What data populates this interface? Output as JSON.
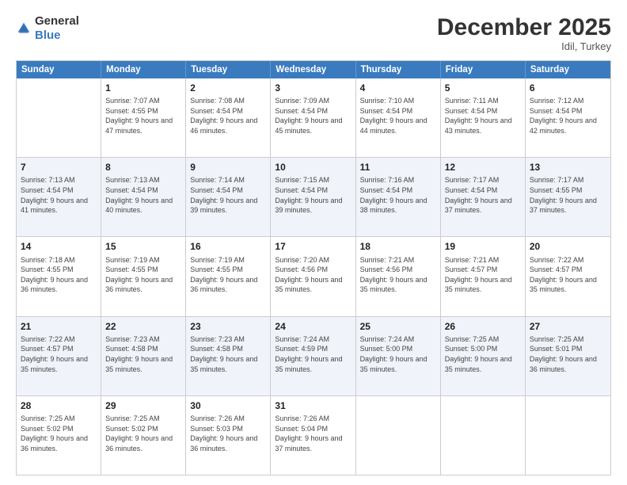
{
  "logo": {
    "general": "General",
    "blue": "Blue"
  },
  "header": {
    "month": "December 2025",
    "location": "Idil, Turkey"
  },
  "weekdays": [
    "Sunday",
    "Monday",
    "Tuesday",
    "Wednesday",
    "Thursday",
    "Friday",
    "Saturday"
  ],
  "rows": [
    [
      {
        "day": "",
        "sunrise": "",
        "sunset": "",
        "daylight": ""
      },
      {
        "day": "1",
        "sunrise": "Sunrise: 7:07 AM",
        "sunset": "Sunset: 4:55 PM",
        "daylight": "Daylight: 9 hours and 47 minutes."
      },
      {
        "day": "2",
        "sunrise": "Sunrise: 7:08 AM",
        "sunset": "Sunset: 4:54 PM",
        "daylight": "Daylight: 9 hours and 46 minutes."
      },
      {
        "day": "3",
        "sunrise": "Sunrise: 7:09 AM",
        "sunset": "Sunset: 4:54 PM",
        "daylight": "Daylight: 9 hours and 45 minutes."
      },
      {
        "day": "4",
        "sunrise": "Sunrise: 7:10 AM",
        "sunset": "Sunset: 4:54 PM",
        "daylight": "Daylight: 9 hours and 44 minutes."
      },
      {
        "day": "5",
        "sunrise": "Sunrise: 7:11 AM",
        "sunset": "Sunset: 4:54 PM",
        "daylight": "Daylight: 9 hours and 43 minutes."
      },
      {
        "day": "6",
        "sunrise": "Sunrise: 7:12 AM",
        "sunset": "Sunset: 4:54 PM",
        "daylight": "Daylight: 9 hours and 42 minutes."
      }
    ],
    [
      {
        "day": "7",
        "sunrise": "Sunrise: 7:13 AM",
        "sunset": "Sunset: 4:54 PM",
        "daylight": "Daylight: 9 hours and 41 minutes."
      },
      {
        "day": "8",
        "sunrise": "Sunrise: 7:13 AM",
        "sunset": "Sunset: 4:54 PM",
        "daylight": "Daylight: 9 hours and 40 minutes."
      },
      {
        "day": "9",
        "sunrise": "Sunrise: 7:14 AM",
        "sunset": "Sunset: 4:54 PM",
        "daylight": "Daylight: 9 hours and 39 minutes."
      },
      {
        "day": "10",
        "sunrise": "Sunrise: 7:15 AM",
        "sunset": "Sunset: 4:54 PM",
        "daylight": "Daylight: 9 hours and 39 minutes."
      },
      {
        "day": "11",
        "sunrise": "Sunrise: 7:16 AM",
        "sunset": "Sunset: 4:54 PM",
        "daylight": "Daylight: 9 hours and 38 minutes."
      },
      {
        "day": "12",
        "sunrise": "Sunrise: 7:17 AM",
        "sunset": "Sunset: 4:54 PM",
        "daylight": "Daylight: 9 hours and 37 minutes."
      },
      {
        "day": "13",
        "sunrise": "Sunrise: 7:17 AM",
        "sunset": "Sunset: 4:55 PM",
        "daylight": "Daylight: 9 hours and 37 minutes."
      }
    ],
    [
      {
        "day": "14",
        "sunrise": "Sunrise: 7:18 AM",
        "sunset": "Sunset: 4:55 PM",
        "daylight": "Daylight: 9 hours and 36 minutes."
      },
      {
        "day": "15",
        "sunrise": "Sunrise: 7:19 AM",
        "sunset": "Sunset: 4:55 PM",
        "daylight": "Daylight: 9 hours and 36 minutes."
      },
      {
        "day": "16",
        "sunrise": "Sunrise: 7:19 AM",
        "sunset": "Sunset: 4:55 PM",
        "daylight": "Daylight: 9 hours and 36 minutes."
      },
      {
        "day": "17",
        "sunrise": "Sunrise: 7:20 AM",
        "sunset": "Sunset: 4:56 PM",
        "daylight": "Daylight: 9 hours and 35 minutes."
      },
      {
        "day": "18",
        "sunrise": "Sunrise: 7:21 AM",
        "sunset": "Sunset: 4:56 PM",
        "daylight": "Daylight: 9 hours and 35 minutes."
      },
      {
        "day": "19",
        "sunrise": "Sunrise: 7:21 AM",
        "sunset": "Sunset: 4:57 PM",
        "daylight": "Daylight: 9 hours and 35 minutes."
      },
      {
        "day": "20",
        "sunrise": "Sunrise: 7:22 AM",
        "sunset": "Sunset: 4:57 PM",
        "daylight": "Daylight: 9 hours and 35 minutes."
      }
    ],
    [
      {
        "day": "21",
        "sunrise": "Sunrise: 7:22 AM",
        "sunset": "Sunset: 4:57 PM",
        "daylight": "Daylight: 9 hours and 35 minutes."
      },
      {
        "day": "22",
        "sunrise": "Sunrise: 7:23 AM",
        "sunset": "Sunset: 4:58 PM",
        "daylight": "Daylight: 9 hours and 35 minutes."
      },
      {
        "day": "23",
        "sunrise": "Sunrise: 7:23 AM",
        "sunset": "Sunset: 4:58 PM",
        "daylight": "Daylight: 9 hours and 35 minutes."
      },
      {
        "day": "24",
        "sunrise": "Sunrise: 7:24 AM",
        "sunset": "Sunset: 4:59 PM",
        "daylight": "Daylight: 9 hours and 35 minutes."
      },
      {
        "day": "25",
        "sunrise": "Sunrise: 7:24 AM",
        "sunset": "Sunset: 5:00 PM",
        "daylight": "Daylight: 9 hours and 35 minutes."
      },
      {
        "day": "26",
        "sunrise": "Sunrise: 7:25 AM",
        "sunset": "Sunset: 5:00 PM",
        "daylight": "Daylight: 9 hours and 35 minutes."
      },
      {
        "day": "27",
        "sunrise": "Sunrise: 7:25 AM",
        "sunset": "Sunset: 5:01 PM",
        "daylight": "Daylight: 9 hours and 36 minutes."
      }
    ],
    [
      {
        "day": "28",
        "sunrise": "Sunrise: 7:25 AM",
        "sunset": "Sunset: 5:02 PM",
        "daylight": "Daylight: 9 hours and 36 minutes."
      },
      {
        "day": "29",
        "sunrise": "Sunrise: 7:25 AM",
        "sunset": "Sunset: 5:02 PM",
        "daylight": "Daylight: 9 hours and 36 minutes."
      },
      {
        "day": "30",
        "sunrise": "Sunrise: 7:26 AM",
        "sunset": "Sunset: 5:03 PM",
        "daylight": "Daylight: 9 hours and 36 minutes."
      },
      {
        "day": "31",
        "sunrise": "Sunrise: 7:26 AM",
        "sunset": "Sunset: 5:04 PM",
        "daylight": "Daylight: 9 hours and 37 minutes."
      },
      {
        "day": "",
        "sunrise": "",
        "sunset": "",
        "daylight": ""
      },
      {
        "day": "",
        "sunrise": "",
        "sunset": "",
        "daylight": ""
      },
      {
        "day": "",
        "sunrise": "",
        "sunset": "",
        "daylight": ""
      }
    ]
  ]
}
